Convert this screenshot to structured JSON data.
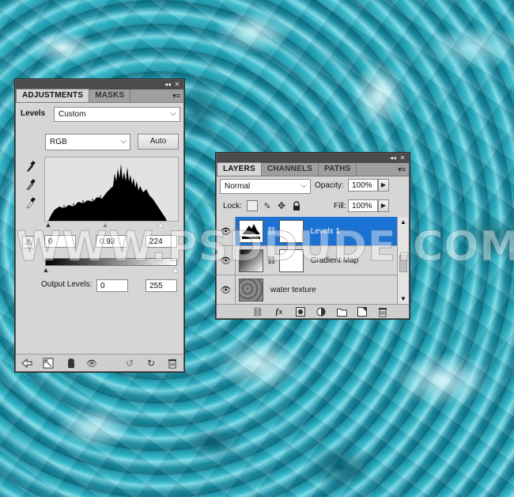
{
  "background": {
    "description_color": "#2aa9bd"
  },
  "watermark": {
    "text": "WWW.PSDDUDE.COM"
  },
  "adjustments_panel": {
    "tabs": [
      {
        "label": "ADJUSTMENTS",
        "active": true
      },
      {
        "label": "MASKS",
        "active": false
      }
    ],
    "preset_label": "Levels",
    "preset_value": "Custom",
    "channel_value": "RGB",
    "auto_label": "Auto",
    "input_levels": {
      "black": "0",
      "gamma": "0.93",
      "white": "224"
    },
    "output_levels_label": "Output Levels:",
    "output_levels": {
      "black": "0",
      "white": "255"
    },
    "icons": [
      "eyedropper-black-icon",
      "eyedropper-gray-icon",
      "eyedropper-white-icon",
      "clip-warning-icon"
    ],
    "bottom_icons": [
      "back-arrow-icon",
      "expand-view-icon",
      "clip-to-layer-icon",
      "visibility-eye-icon",
      "previous-state-icon",
      "reset-icon",
      "delete-icon"
    ]
  },
  "layers_panel": {
    "tabs": [
      {
        "label": "LAYERS",
        "active": true
      },
      {
        "label": "CHANNELS",
        "active": false
      },
      {
        "label": "PATHS",
        "active": false
      }
    ],
    "blend_mode": "Normal",
    "opacity_label": "Opacity:",
    "opacity_value": "100%",
    "lock_label": "Lock:",
    "fill_label": "Fill:",
    "fill_value": "100%",
    "layers": [
      {
        "name": "Levels 1",
        "selected": true
      },
      {
        "name": "Gradient Map",
        "selected": false
      },
      {
        "name": "water texture",
        "selected": false
      }
    ],
    "bottom_icons": [
      "link-layers-icon",
      "fx-icon",
      "layer-mask-icon",
      "adjustment-layer-icon",
      "group-folder-icon",
      "new-layer-icon",
      "trash-icon"
    ],
    "fx_label": "fx"
  },
  "colors": {
    "selection": "#1a73d4",
    "panel": "#d6d6d6",
    "tabbar": "#9f9f9f"
  }
}
